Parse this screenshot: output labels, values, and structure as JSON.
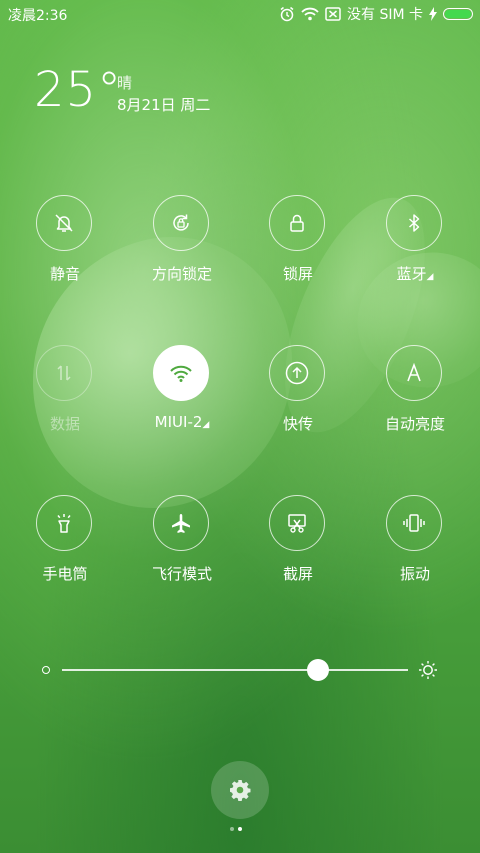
{
  "status_bar": {
    "time": "凌晨2:36",
    "no_sim": "没有 SIM 卡",
    "battery_level": 1.0,
    "battery_color": "#44d94e"
  },
  "weather": {
    "temperature": "25°",
    "condition": "晴",
    "date": "8月21日 周二"
  },
  "toggles": [
    {
      "label": "静音",
      "icon": "bell-off-icon",
      "active": false
    },
    {
      "label": "方向锁定",
      "icon": "rotation-lock-icon",
      "active": false
    },
    {
      "label": "锁屏",
      "icon": "lock-icon",
      "active": false
    },
    {
      "label": "蓝牙",
      "icon": "bluetooth-icon",
      "active": false
    },
    {
      "label": "数据",
      "icon": "mobile-data-icon",
      "active": false,
      "disabled": true
    },
    {
      "label": "MIUI-2",
      "icon": "wifi-icon",
      "active": true
    },
    {
      "label": "快传",
      "icon": "fast-transfer-icon",
      "active": false
    },
    {
      "label": "自动亮度",
      "icon": "auto-brightness-icon",
      "active": false
    },
    {
      "label": "手电筒",
      "icon": "flashlight-icon",
      "active": false
    },
    {
      "label": "飞行模式",
      "icon": "airplane-icon",
      "active": false
    },
    {
      "label": "截屏",
      "icon": "screenshot-icon",
      "active": false
    },
    {
      "label": "振动",
      "icon": "vibrate-icon",
      "active": false
    }
  ],
  "brightness": {
    "value": 0.74
  },
  "settings_icon": "gear-icon",
  "pager": {
    "pages": 2,
    "current": 2
  }
}
